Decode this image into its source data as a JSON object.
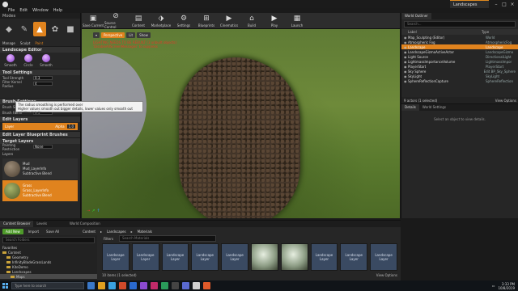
{
  "titlebar": {
    "menus": [
      "File",
      "Edit",
      "Window",
      "Help"
    ],
    "doc_tab": "Landscapes"
  },
  "modes": {
    "header": "Modes",
    "mode_icons": [
      "place-icon",
      "paint-icon",
      "landscape-icon",
      "foliage-icon",
      "geometry-icon"
    ],
    "submodes": [
      "Manage",
      "Sculpt",
      "Paint"
    ],
    "landscape_editor_label": "Landscape Editor",
    "tools": [
      "Smooth",
      "Circle",
      "Smooth"
    ],
    "tool_settings_label": "Tool Settings",
    "tool_strength_label": "Tool Strength",
    "tool_strength_value": "0.3",
    "filter_kernel_label": "Filter Kernel Radius",
    "filter_kernel_value": "4",
    "tooltip_line1": "The radius smoothing is performed over",
    "tooltip_line2": "Higher values smooth out bigger details, lower values only smooth out smaller details",
    "brush_settings_label": "Brush Settings",
    "brush_size_label": "Brush Size",
    "brush_size_value": "2048.0",
    "brush_falloff_label": "Brush Falloff",
    "brush_falloff_value": "0.5",
    "edit_layers_label": "Edit Layers",
    "layer_name": "Layer",
    "layer_visibility": "Alpha",
    "layer_alpha_value": "1.0",
    "edit_blueprint_brushes_label": "Edit Layer Blueprint Brushes",
    "target_layers_label": "Target Layers",
    "painting_restriction_label": "Painting Restriction",
    "painting_restriction_value": "None",
    "layers_label": "Layers",
    "layer_rows": [
      {
        "line1": "Mud",
        "line2": "Mud_LayerInfo",
        "line3": "Subtractive Blend"
      },
      {
        "line1": "Grass",
        "line2": "Grass_LayerInfo",
        "line3": "Subtractive Blend"
      }
    ]
  },
  "toolbar": {
    "buttons": [
      {
        "label": "Save Current",
        "icon": "save-icon"
      },
      {
        "label": "Source Control",
        "icon": "source-control-icon"
      },
      {
        "label": "Content",
        "icon": "content-icon"
      },
      {
        "label": "Marketplace",
        "icon": "marketplace-icon"
      },
      {
        "label": "Settings",
        "icon": "settings-icon"
      },
      {
        "label": "Blueprints",
        "icon": "blueprints-icon"
      },
      {
        "label": "Cinematics",
        "icon": "cinematics-icon"
      },
      {
        "label": "Build",
        "icon": "build-icon"
      },
      {
        "label": "Play",
        "icon": "play-icon"
      },
      {
        "label": "Launch",
        "icon": "launch-icon"
      }
    ]
  },
  "viewport": {
    "perspective_label": "Perspective",
    "lit_label": "Lit",
    "show_label": "Show",
    "warning_line1": "LIGHTING NEEDS TO BE REBUILT (3 unbuilt objects)",
    "warning_line2": "'DisableAllScreenMessages' to suppress"
  },
  "outliner": {
    "tab_label": "World Outliner",
    "search_placeholder": "Search...",
    "col_label": "Label",
    "col_type": "Type",
    "rows": [
      {
        "name": "Map_Sculpting (Editor)",
        "type": "World",
        "selected": false
      },
      {
        "name": "Atmospheric Fog",
        "type": "AtmosphericFog",
        "selected": false
      },
      {
        "name": "Landscape",
        "type": "Landscape",
        "selected": true
      },
      {
        "name": "LandscapeGizmoActiveActor",
        "type": "LandscapeGizmo",
        "selected": false
      },
      {
        "name": "Light Source",
        "type": "DirectionalLight",
        "selected": false
      },
      {
        "name": "LightmassImportanceVolume",
        "type": "LightmassImpor",
        "selected": false
      },
      {
        "name": "PlayerStart",
        "type": "PlayerStart",
        "selected": false
      },
      {
        "name": "Sky Sphere",
        "type": "Edit BP_Sky_Sphere",
        "selected": false
      },
      {
        "name": "SkyLight",
        "type": "SkyLight",
        "selected": false
      },
      {
        "name": "SphereReflectionCapture",
        "type": "SphereReflection",
        "selected": false
      }
    ],
    "footer_count": "9 actors (1 selected)",
    "view_options": "View Options"
  },
  "details": {
    "tab_details": "Details",
    "tab_world_settings": "World Settings",
    "empty_text": "Select an object to view details."
  },
  "content_browser": {
    "tab_content": "Content Browser",
    "tab_levels": "Levels",
    "tab_world_comp": "World Composition",
    "add_new": "Add New",
    "import": "Import",
    "save_all": "Save All",
    "breadcrumbs": [
      "Content",
      "Landscapes",
      "Materials"
    ],
    "search_folders": "Search Folders",
    "filters": "Filters",
    "search_materials": "Search Materials",
    "tree": [
      {
        "label": "Favorites",
        "selected": false
      },
      {
        "label": "Content",
        "selected": false
      },
      {
        "label": "Geometry",
        "selected": false
      },
      {
        "label": "InfinityBladeGrassLands",
        "selected": false
      },
      {
        "label": "KiteDemo",
        "selected": false
      },
      {
        "label": "Landscapes",
        "selected": false
      },
      {
        "label": "Maps",
        "selected": true
      }
    ],
    "tiles": [
      {
        "label": "Landscape Layer",
        "kind": "layer"
      },
      {
        "label": "Landscape Layer",
        "kind": "layer"
      },
      {
        "label": "Landscape Layer",
        "kind": "layer"
      },
      {
        "label": "Landscape Layer",
        "kind": "layer"
      },
      {
        "label": "Landscape Layer",
        "kind": "layer"
      },
      {
        "label": "",
        "kind": "material"
      },
      {
        "label": "",
        "kind": "material"
      },
      {
        "label": "Landscape Layer",
        "kind": "layer"
      },
      {
        "label": "Landscape Layer",
        "kind": "layer"
      },
      {
        "label": "Landscape Layer",
        "kind": "layer"
      }
    ],
    "footer_count": "10 items (1 selected)",
    "view_options": "View Options"
  },
  "taskbar": {
    "search_placeholder": "Type here to search",
    "time": "3:33 PM",
    "date": "10/8/2019",
    "apps": [
      "#3a78c8",
      "#e0a020",
      "#3aa0e0",
      "#d04a2a",
      "#2a6ad0",
      "#8a4ad0",
      "#c02a6a",
      "#2a9a5a",
      "#444",
      "#5a6ad0",
      "#d0d0d0",
      "#e05a2a"
    ]
  }
}
